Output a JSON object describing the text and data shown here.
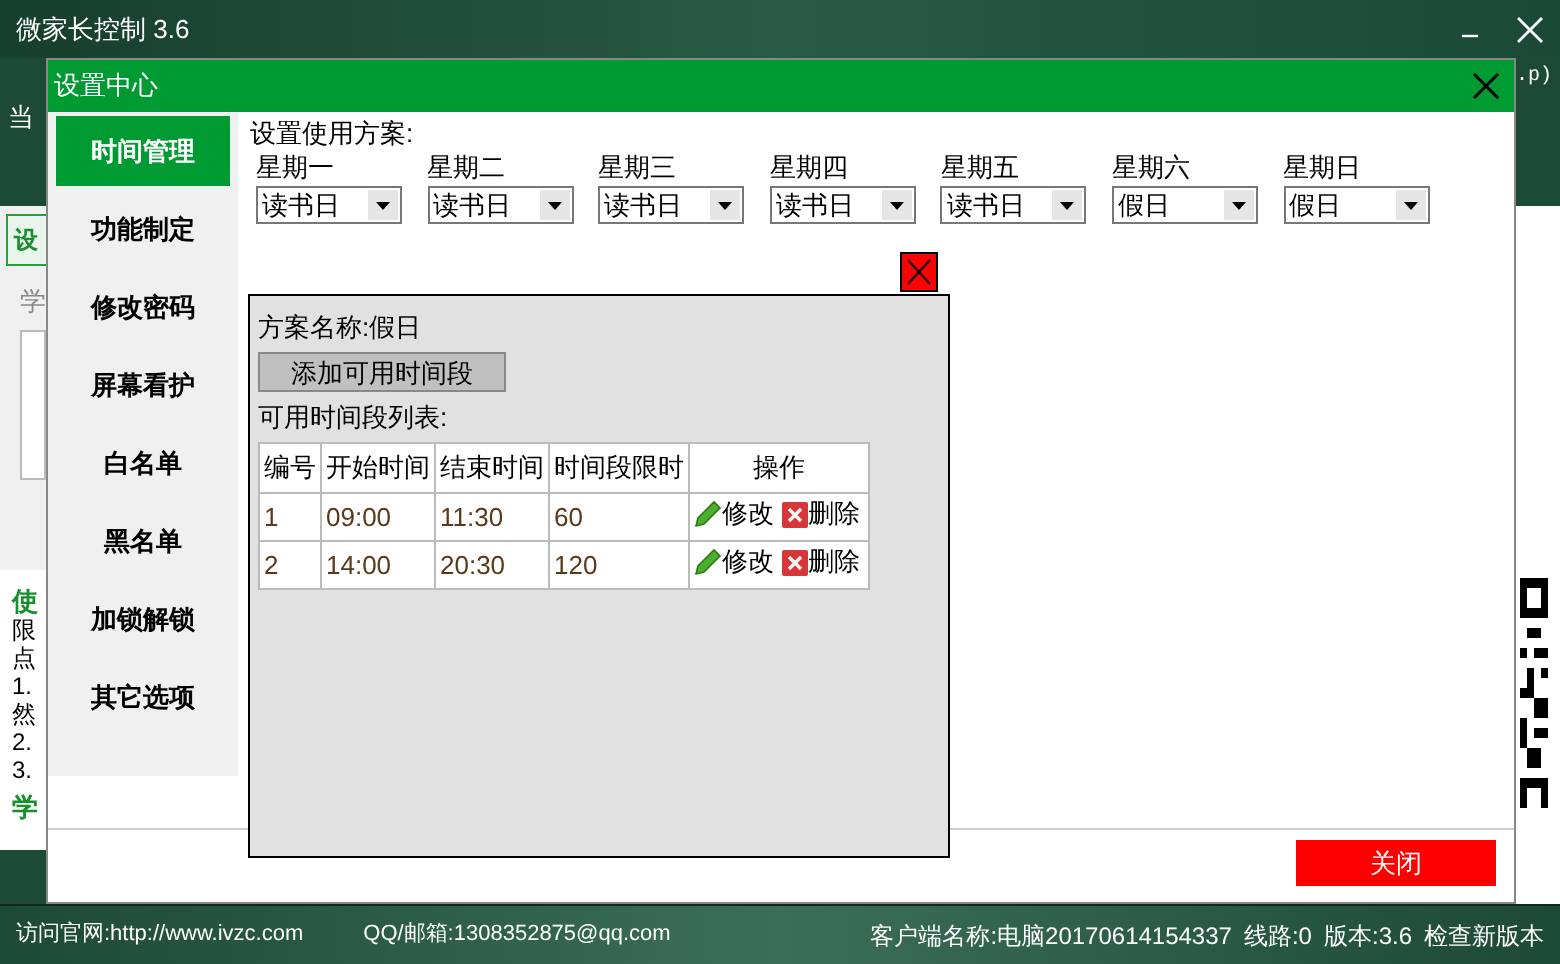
{
  "main_window": {
    "title": "微家长控制 3.6",
    "left_fragments": [
      {
        "kind": "dark",
        "text": "当"
      },
      {
        "kind": "tab",
        "text": "设"
      },
      {
        "kind": "gray",
        "text": "学"
      },
      {
        "kind": "green",
        "text": "使"
      },
      {
        "kind": "plain",
        "text": "限"
      },
      {
        "kind": "plain",
        "text": "点"
      },
      {
        "kind": "plain",
        "text": "1."
      },
      {
        "kind": "plain",
        "text": "然"
      },
      {
        "kind": "plain",
        "text": "2."
      },
      {
        "kind": "plain",
        "text": "3."
      },
      {
        "kind": "green",
        "text": "学"
      }
    ],
    "right_fragment": ".p)"
  },
  "dialog": {
    "title": "设置中心",
    "sidebar": [
      {
        "label": "时间管理",
        "selected": true
      },
      {
        "label": "功能制定",
        "selected": false
      },
      {
        "label": "修改密码",
        "selected": false
      },
      {
        "label": "屏幕看护",
        "selected": false
      },
      {
        "label": "白名单",
        "selected": false
      },
      {
        "label": "黑名单",
        "selected": false
      },
      {
        "label": "加锁解锁",
        "selected": false
      },
      {
        "label": "其它选项",
        "selected": false
      }
    ],
    "plan_label": "设置使用方案:",
    "days": [
      {
        "day": "星期一",
        "value": "读书日"
      },
      {
        "day": "星期二",
        "value": "读书日"
      },
      {
        "day": "星期三",
        "value": "读书日"
      },
      {
        "day": "星期四",
        "value": "读书日"
      },
      {
        "day": "星期五",
        "value": "读书日"
      },
      {
        "day": "星期六",
        "value": "假日"
      },
      {
        "day": "星期日",
        "value": "假日"
      }
    ],
    "plan_panel": {
      "name_label": "方案名称:",
      "name": "假日",
      "add_button": "添加可用时间段",
      "list_label": "可用时间段列表:",
      "columns": [
        "编号",
        "开始时间",
        "结束时间",
        "时间段限时",
        "操作"
      ],
      "rows": [
        {
          "cells": [
            "1",
            "09:00",
            "11:30",
            "60"
          ],
          "edit": "修改",
          "delete": "删除"
        },
        {
          "cells": [
            "2",
            "14:00",
            "20:30",
            "120"
          ],
          "edit": "修改",
          "delete": "删除"
        }
      ]
    },
    "close_button": "关闭"
  },
  "status_bar": {
    "left": [
      "访问官网:http://www.ivzc.com",
      "QQ/邮箱:1308352875@qq.com"
    ],
    "right": [
      "客户端名称:电脑20170614154337",
      "线路:0",
      "版本:3.6",
      "检查新版本"
    ]
  }
}
